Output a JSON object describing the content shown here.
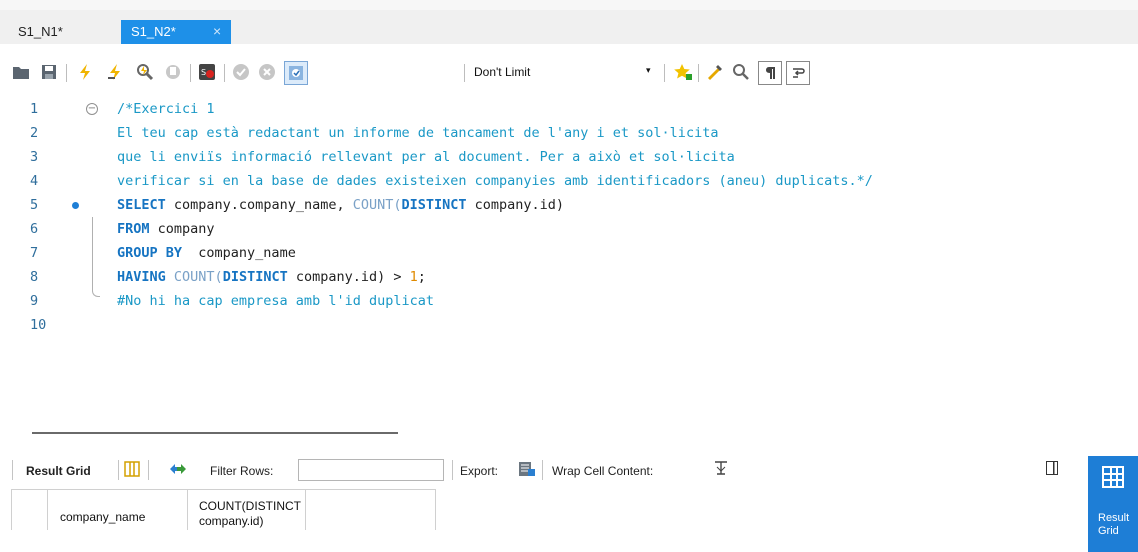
{
  "tabs": [
    {
      "label": "S1_N1*",
      "active": false
    },
    {
      "label": "S1_N2*",
      "active": true,
      "close": "×"
    }
  ],
  "toolbar": {
    "icons": [
      "open-folder-icon",
      "save-icon",
      "execute-icon",
      "execute-current-icon",
      "explain-icon",
      "stop-icon",
      "toggle-error-icon",
      "commit-icon",
      "rollback-icon",
      "autocommit-icon"
    ],
    "limit_value": "Don't Limit",
    "limit_arrow": "▾",
    "right_icons": [
      "bookmark-star-icon",
      "beautify-icon",
      "find-icon",
      "invisible-chars-icon",
      "wrap-lines-icon"
    ]
  },
  "editor": {
    "lines": [
      {
        "n": "1",
        "text": "/*Exercici 1"
      },
      {
        "n": "2",
        "text": "El teu cap està redactant un informe de tancament de l'any i et sol·licita"
      },
      {
        "n": "3",
        "text": "que li enviïs informació rellevant per al document. Per a això et sol·licita"
      },
      {
        "n": "4",
        "text": "verificar si en la base de dades existeixen companyies amb identificadors (aneu) duplicats.*/"
      },
      {
        "n": "5",
        "tokens": [
          {
            "t": "SELECT",
            "c": "kw"
          },
          {
            "t": " company.company_name, ",
            "c": "id"
          },
          {
            "t": "COUNT(",
            "c": "fn"
          },
          {
            "t": "DISTINCT",
            "c": "kw"
          },
          {
            "t": " company.id)",
            "c": "id"
          }
        ]
      },
      {
        "n": "6",
        "tokens": [
          {
            "t": "FROM",
            "c": "kw"
          },
          {
            "t": " company",
            "c": "id"
          }
        ]
      },
      {
        "n": "7",
        "tokens": [
          {
            "t": "GROUP BY",
            "c": "kw"
          },
          {
            "t": "  company_name",
            "c": "id"
          }
        ]
      },
      {
        "n": "8",
        "tokens": [
          {
            "t": "HAVING ",
            "c": "kw"
          },
          {
            "t": "COUNT(",
            "c": "fn"
          },
          {
            "t": "DISTINCT",
            "c": "kw"
          },
          {
            "t": " company.id) > ",
            "c": "id"
          },
          {
            "t": "1",
            "c": "num"
          },
          {
            "t": ";",
            "c": "id"
          }
        ]
      },
      {
        "n": "9",
        "text": "#No hi ha cap empresa amb l'id duplicat"
      },
      {
        "n": "10",
        "text": ""
      }
    ]
  },
  "results": {
    "result_grid_label": "Result Grid",
    "filter_label": "Filter Rows:",
    "filter_value": "",
    "export_label": "Export:",
    "wrap_label": "Wrap Cell Content:",
    "columns": [
      "company_name",
      "COUNT(DISTINCT company.id)"
    ],
    "col2_line1": "COUNT(DISTINCT",
    "col2_line2": "company.id)"
  },
  "side_panel": {
    "label": "Result Grid",
    "label_display": "Result\nGrid"
  },
  "colors": {
    "accent": "#1e7ed6",
    "comment": "#1a98c6",
    "keyword": "#1674c2"
  }
}
